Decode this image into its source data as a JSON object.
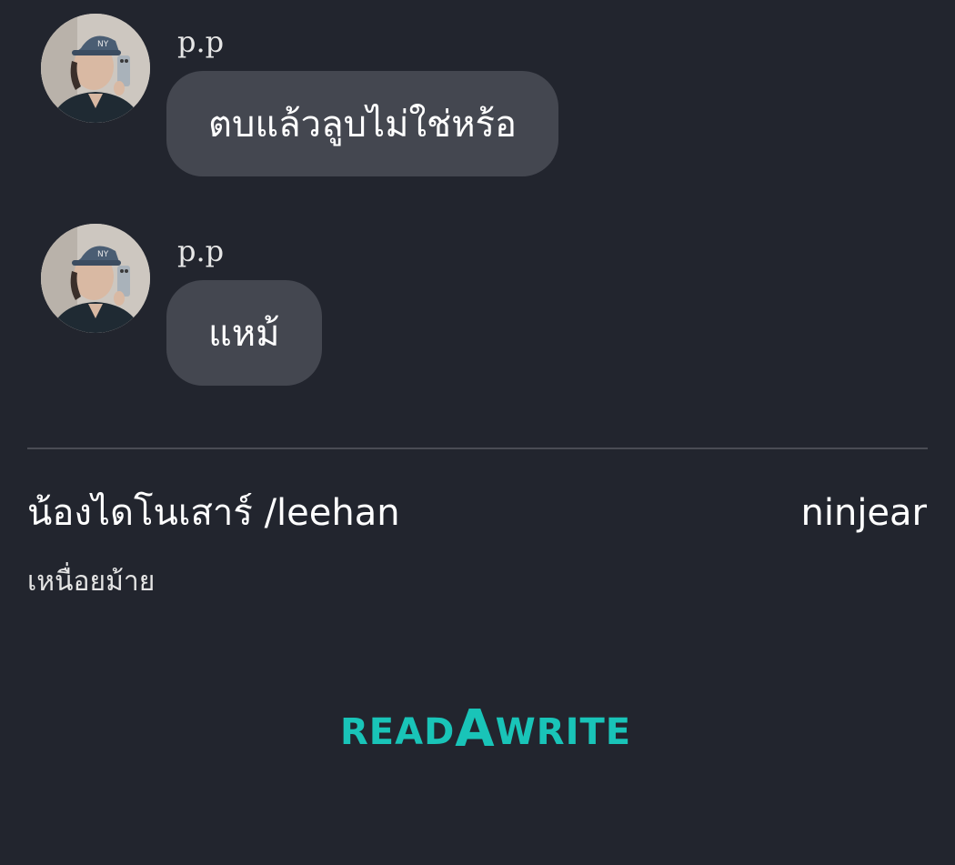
{
  "messages": [
    {
      "sender": "p.p",
      "text": "ตบแล้วลูบไม่ใช่หร้อ"
    },
    {
      "sender": "p.p",
      "text": "แหม้"
    }
  ],
  "footer": {
    "chapter_title": "น้องไดโนเสาร์ /leehan",
    "author": "ninjear",
    "subtitle": "เหนื่อยม้าย"
  },
  "brand": {
    "logo_prefix": "READ",
    "logo_a": "A",
    "logo_suffix": "WRITE",
    "logo_color": "#19c4b8"
  },
  "colors": {
    "background": "#22252e",
    "bubble": "#444750"
  }
}
